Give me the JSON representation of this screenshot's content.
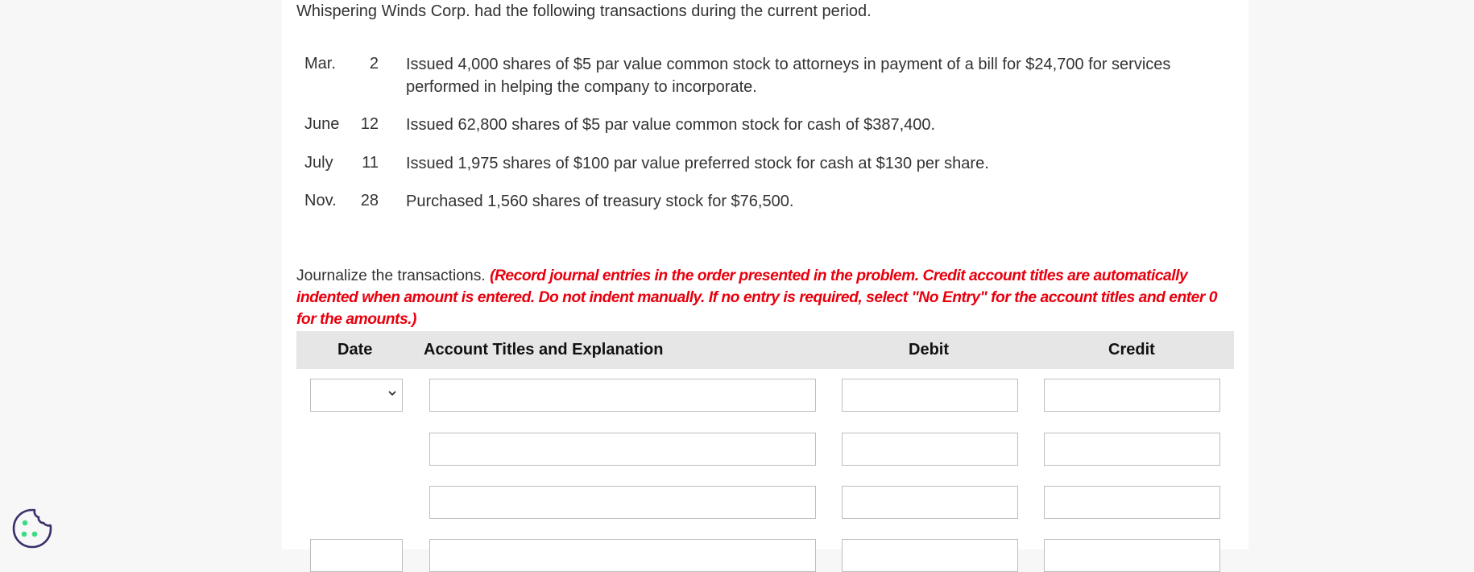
{
  "intro": "Whispering Winds Corp. had the following transactions during the current period.",
  "transactions": [
    {
      "month": "Mar.",
      "day": "2",
      "line1": "Issued 4,000 shares of $5 par value common stock to attorneys in payment of a bill for $24,700 for services",
      "line2": "performed in helping the company to incorporate."
    },
    {
      "month": "June",
      "day": "12",
      "line1": "Issued 62,800 shares of $5 par value common stock for cash of $387,400.",
      "line2": ""
    },
    {
      "month": "July",
      "day": "11",
      "line1": "Issued 1,975 shares of $100 par value preferred stock for cash at $130 per share.",
      "line2": ""
    },
    {
      "month": "Nov.",
      "day": "28",
      "line1": "Purchased 1,560 shares of treasury stock for $76,500.",
      "line2": ""
    }
  ],
  "instructions": {
    "lead": "Journalize the transactions.",
    "note": "(Record journal entries in the order presented in the problem. Credit account titles are automatically indented when amount is entered. Do not indent manually. If no entry is required, select \"No Entry\" for the account titles and enter 0 for the amounts.)"
  },
  "table": {
    "headers": {
      "date": "Date",
      "account": "Account Titles and Explanation",
      "debit": "Debit",
      "credit": "Credit"
    },
    "rows": [
      {
        "date": "",
        "account": "",
        "debit": "",
        "credit": ""
      },
      {
        "account": "",
        "debit": "",
        "credit": ""
      },
      {
        "account": "",
        "debit": "",
        "credit": ""
      },
      {
        "date": "",
        "account": "",
        "debit": "",
        "credit": ""
      }
    ]
  },
  "icons": {
    "date_dropdown": "chevron-down-icon",
    "cookie": "cookie-icon"
  },
  "colors": {
    "instruction_red": "#e8000e",
    "header_bg": "#e6e6e6",
    "cookie_outline": "#3b2f6b",
    "cookie_dots": "#3ddc84"
  }
}
